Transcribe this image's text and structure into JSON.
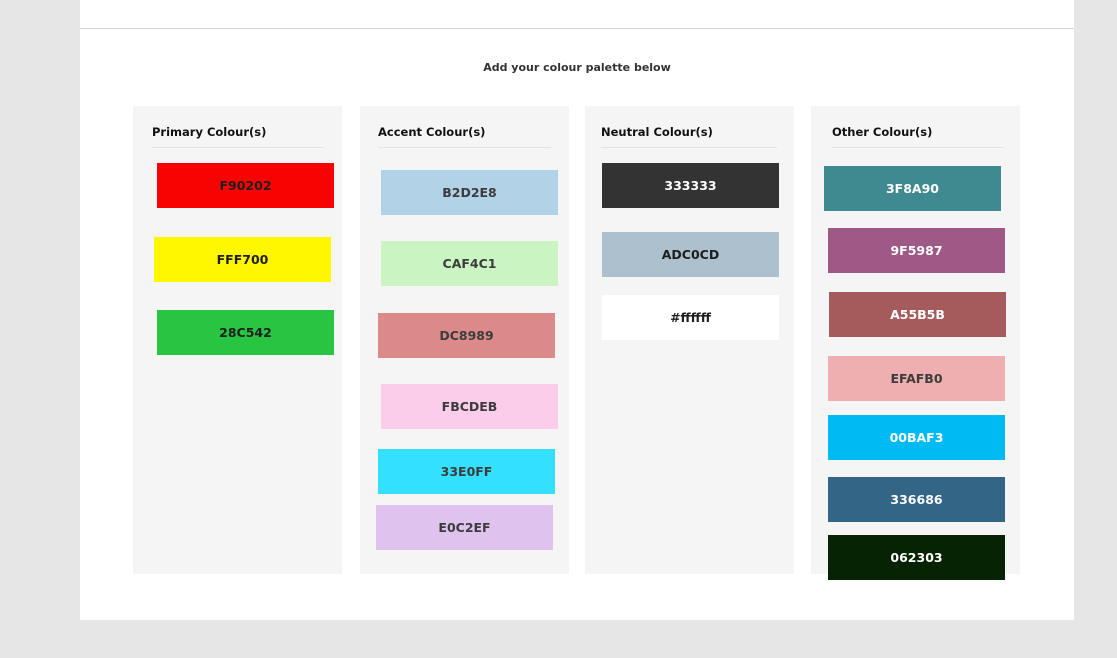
{
  "heading": "Add your colour palette below",
  "columns": {
    "primary": {
      "title": "Primary Colour(s)",
      "swatches": [
        {
          "label": "F90202",
          "color": "#F90202"
        },
        {
          "label": "FFF700",
          "color": "#FFF700"
        },
        {
          "label": "28C542",
          "color": "#28C542"
        }
      ]
    },
    "accent": {
      "title": "Accent Colour(s)",
      "swatches": [
        {
          "label": "B2D2E8",
          "color": "#B2D2E8"
        },
        {
          "label": "CAF4C1",
          "color": "#CAF4C1"
        },
        {
          "label": "DC8989",
          "color": "#DC8989"
        },
        {
          "label": "FBCDEB",
          "color": "#FBCDEB"
        },
        {
          "label": "33E0FF",
          "color": "#33E0FF"
        },
        {
          "label": "E0C2EF",
          "color": "#E0C2EF"
        }
      ]
    },
    "neutral": {
      "title": "Neutral Colour(s)",
      "swatches": [
        {
          "label": "333333",
          "color": "#333333"
        },
        {
          "label": "ADC0CD",
          "color": "#ADC0CD"
        },
        {
          "label": "#ffffff",
          "color": "#ffffff"
        }
      ]
    },
    "other": {
      "title": "Other Colour(s)",
      "swatches": [
        {
          "label": "3F8A90",
          "color": "#3F8A90"
        },
        {
          "label": "9F5987",
          "color": "#9F5987"
        },
        {
          "label": "A55B5B",
          "color": "#A55B5B"
        },
        {
          "label": "EFAFB0",
          "color": "#EFAFB0"
        },
        {
          "label": "00BAF3",
          "color": "#00BAF3"
        },
        {
          "label": "336686",
          "color": "#336686"
        },
        {
          "label": "062303",
          "color": "#062303"
        }
      ]
    }
  }
}
